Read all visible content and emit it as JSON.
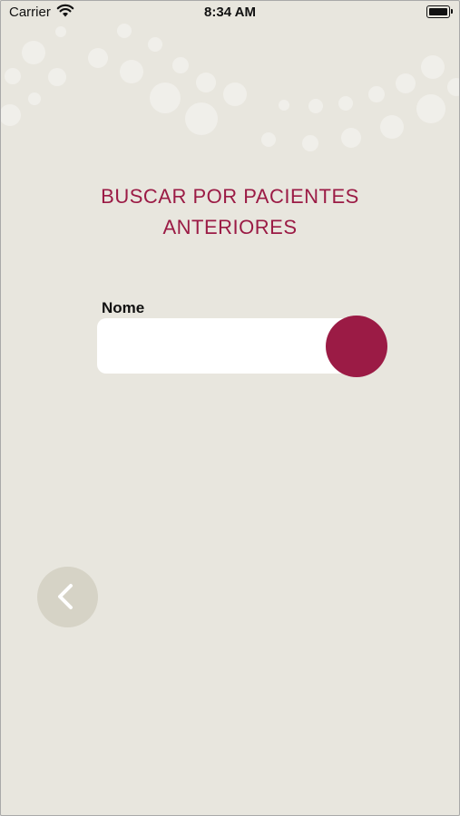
{
  "status_bar": {
    "carrier": "Carrier",
    "time": "8:34 AM",
    "icons": [
      "wifi-icon",
      "battery-icon"
    ]
  },
  "page": {
    "title_line1": "BUSCAR POR PACIENTES",
    "title_line2": "ANTERIORES"
  },
  "search": {
    "label": "Nome",
    "value": "",
    "placeholder": ""
  },
  "colors": {
    "background": "#e8e6de",
    "accent": "#9b1b45",
    "back_button": "#d6d3c6"
  }
}
